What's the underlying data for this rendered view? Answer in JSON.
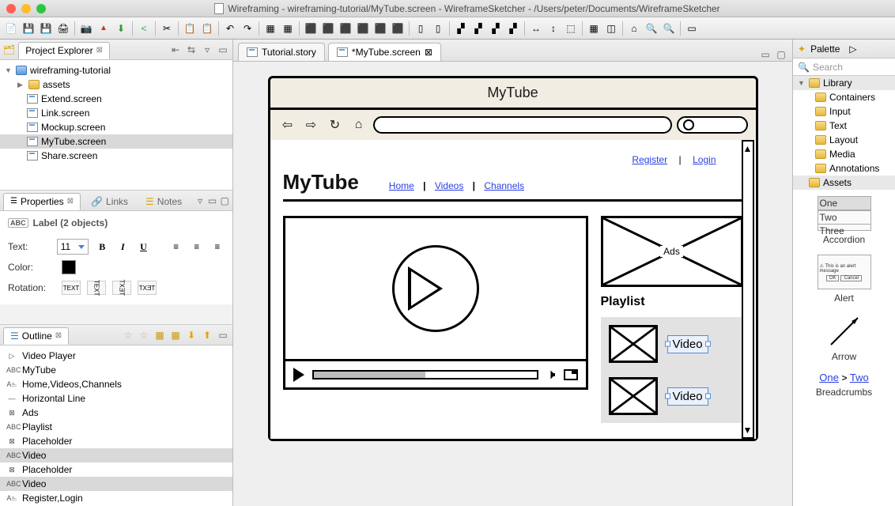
{
  "window": {
    "title": "Wireframing - wireframing-tutorial/MyTube.screen - WireframeSketcher - /Users/peter/Documents/WireframeSketcher"
  },
  "project_explorer": {
    "title": "Project Explorer",
    "root": "wireframing-tutorial",
    "folders": [
      "assets"
    ],
    "files": [
      "Extend.screen",
      "Link.screen",
      "Mockup.screen",
      "MyTube.screen",
      "Share.screen"
    ],
    "selected": "MyTube.screen"
  },
  "properties": {
    "tabs": [
      "Properties",
      "Links",
      "Notes"
    ],
    "heading": "Label (2 objects)",
    "text_label": "Text:",
    "font_size": "11",
    "color_label": "Color:",
    "rotation_label": "Rotation:"
  },
  "outline": {
    "title": "Outline",
    "items": [
      {
        "icon": "▷",
        "label": "Video Player"
      },
      {
        "icon": "ABC",
        "label": "MyTube"
      },
      {
        "icon": "A⎁",
        "label": "Home,Videos,Channels"
      },
      {
        "icon": "—",
        "label": "Horizontal Line"
      },
      {
        "icon": "⊠",
        "label": "Ads"
      },
      {
        "icon": "ABC",
        "label": "Playlist"
      },
      {
        "icon": "⊠",
        "label": "Placeholder"
      },
      {
        "icon": "ABC",
        "label": "Video",
        "selected": true
      },
      {
        "icon": "⊠",
        "label": "Placeholder"
      },
      {
        "icon": "ABC",
        "label": "Video",
        "selected": true
      },
      {
        "icon": "A⎁",
        "label": "Register,Login"
      }
    ]
  },
  "editor": {
    "tabs": [
      {
        "label": "Tutorial.story",
        "active": false
      },
      {
        "label": "*MyTube.screen",
        "active": true
      }
    ]
  },
  "wireframe": {
    "window_title": "MyTube",
    "top_links": [
      "Register",
      "Login"
    ],
    "logo": "MyTube",
    "nav": [
      "Home",
      "Videos",
      "Channels"
    ],
    "ads_label": "Ads",
    "playlist_title": "Playlist",
    "playlist_items": [
      "Video",
      "Video"
    ]
  },
  "palette": {
    "title": "Palette",
    "search_placeholder": "Search",
    "library_label": "Library",
    "categories": [
      "Containers",
      "Input",
      "Text",
      "Layout",
      "Media",
      "Annotations"
    ],
    "assets_label": "Assets",
    "items": [
      {
        "label": "Accordion"
      },
      {
        "label": "Alert"
      },
      {
        "label": "Arrow"
      },
      {
        "label": "Breadcrumbs"
      }
    ],
    "breadcrumb_sample": [
      "One",
      "Two"
    ],
    "accordion_sample": [
      "One",
      "Two",
      "Three"
    ]
  }
}
